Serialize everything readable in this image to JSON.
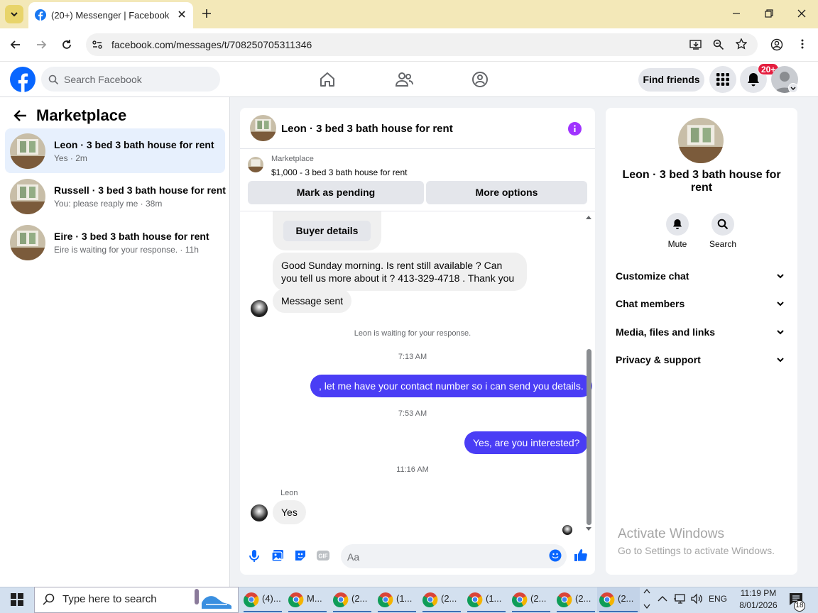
{
  "browser": {
    "tab_title": "(20+) Messenger | Facebook",
    "url": "facebook.com/messages/t/708250705311346"
  },
  "fb": {
    "search_placeholder": "Search Facebook",
    "find_friends": "Find friends",
    "notif_count": "20+"
  },
  "left": {
    "title": "Marketplace",
    "conversations": [
      {
        "name": "Leon · 3 bed 3 bath house for rent",
        "sub": "Yes · 2m"
      },
      {
        "name": "Russell · 3 bed 3 bath house for rent",
        "sub": "You: please reaply me · 38m"
      },
      {
        "name": "Eire · 3 bed 3 bath house for rent",
        "sub": "Eire is waiting for your response. · 11h"
      }
    ]
  },
  "chat": {
    "title": "Leon · 3 bed 3 bath house for rent",
    "listing_source": "Marketplace",
    "listing_price": "$1,000 - 3 bed 3 bath house for rent",
    "mark_pending": "Mark as pending",
    "more_options": "More options",
    "buyer_details": "Buyer details",
    "msg_incoming_1": "Good Sunday morning.  Is rent still available  ?  Can you tell us more about it ? 413-329-4718 . Thank you",
    "msg_sent_label": "Message sent",
    "waiting": "Leon is waiting for your response.",
    "time_1": "7:13 AM",
    "msg_out_1": ", let me have your contact number so i can send you details.",
    "time_2": "7:53 AM",
    "msg_out_2": "Yes, are you interested?",
    "time_3": "11:16 AM",
    "sender_name": "Leon",
    "msg_incoming_2": "Yes",
    "composer_placeholder": "Aa"
  },
  "right": {
    "name": "Leon · 3 bed 3 bath house for rent",
    "mute": "Mute",
    "search": "Search",
    "rows": [
      "Customize chat",
      "Chat members",
      "Media, files and links",
      "Privacy & support"
    ]
  },
  "watermark": {
    "line1": "Activate Windows",
    "line2": "Go to Settings to activate Windows."
  },
  "taskbar": {
    "search_placeholder": "Type here to search",
    "apps": [
      "(4)...",
      "M...",
      "(2...",
      "(1...",
      "(2...",
      "(1...",
      "(2...",
      "(2...",
      "(2..."
    ],
    "lang": "ENG",
    "time": "11:19 PM",
    "date": "8/01/2026",
    "notif_count": "18"
  }
}
